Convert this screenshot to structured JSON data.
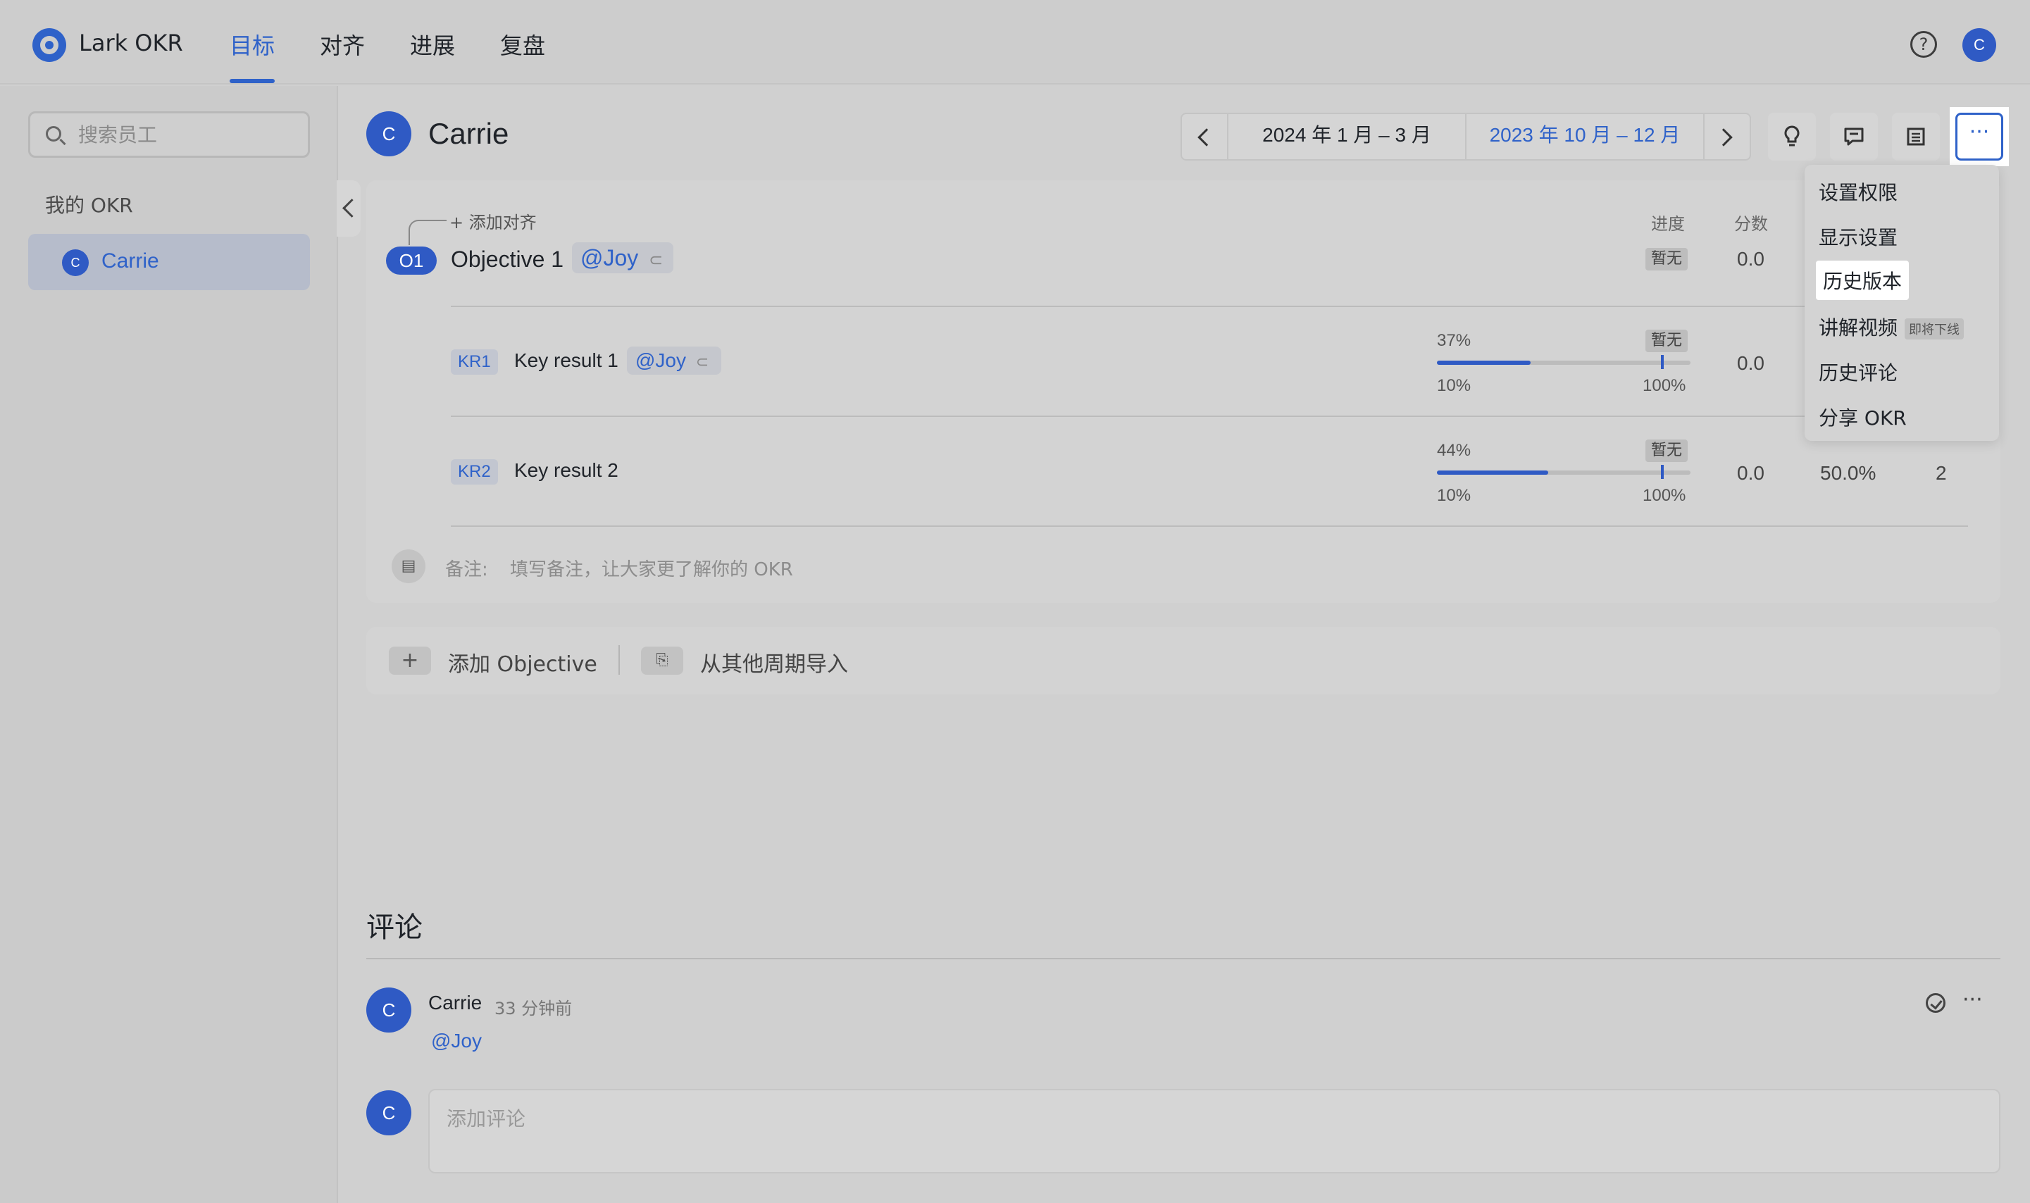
{
  "app": {
    "brand": "Lark OKR",
    "nav_tabs": [
      {
        "label": "目标",
        "active": true
      },
      {
        "label": "对齐",
        "active": false
      },
      {
        "label": "进展",
        "active": false
      },
      {
        "label": "复盘",
        "active": false
      }
    ],
    "help_icon_label": "?",
    "user_initial": "C"
  },
  "sidebar": {
    "search_placeholder": "搜索员工",
    "section_label": "我的 OKR",
    "selected_user": {
      "initial": "C",
      "name": "Carrie"
    }
  },
  "header": {
    "owner_initial": "C",
    "owner_name": "Carrie",
    "current_period": "2024 年 1 月 – 3 月",
    "compare_period": "2023 年 10 月 – 12 月",
    "more_label": "···"
  },
  "okr": {
    "add_align_label": "+ 添加对齐",
    "columns": {
      "progress": "进度",
      "score": "分数"
    },
    "objective": {
      "badge": "O1",
      "title": "Objective 1",
      "mention": "@Joy",
      "progress_chip": "暂无",
      "score": "0.0"
    },
    "key_results": [
      {
        "badge": "KR1",
        "title": "Key result 1",
        "mention": "@Joy",
        "progress_pct": "37%",
        "progress_value": 0.37,
        "start": "10%",
        "target": "100%",
        "chip": "暂无",
        "score": "0.0"
      },
      {
        "badge": "KR2",
        "title": "Key result 2",
        "progress_pct": "44%",
        "progress_value": 0.44,
        "start": "10%",
        "target": "100%",
        "chip": "暂无",
        "score": "0.0",
        "weight": "50.0%",
        "extra": "2"
      }
    ],
    "note_label": "备注:",
    "note_placeholder": "填写备注，让大家更了解你的 OKR"
  },
  "actions": {
    "add_objective": "添加 Objective",
    "import_label": "从其他周期导入"
  },
  "comments": {
    "title": "评论",
    "items": [
      {
        "initial": "C",
        "author": "Carrie",
        "time": "33 分钟前",
        "body": "@Joy"
      }
    ],
    "input_initial": "C",
    "input_placeholder": "添加评论"
  },
  "more_menu": {
    "items": [
      {
        "label": "设置权限"
      },
      {
        "label": "显示设置"
      },
      {
        "label": "历史版本",
        "highlighted": true
      },
      {
        "label": "讲解视频",
        "badge": "即将下线"
      },
      {
        "label": "历史评论"
      },
      {
        "label": "分享 OKR"
      }
    ]
  }
}
